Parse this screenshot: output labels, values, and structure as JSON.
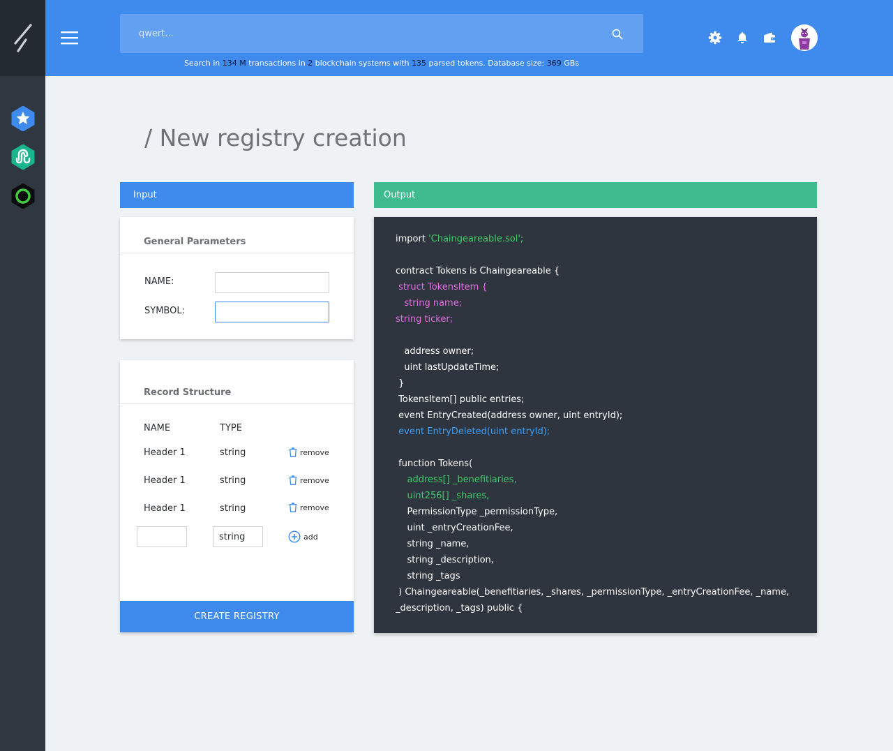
{
  "colors": {
    "topbar": "#3f8aed",
    "sidebar": "#2f3741",
    "input_header": "#3f8aed",
    "output_header": "#3fbb8f",
    "code_bg": "#2e353e",
    "code_string": "#3fcc6a",
    "code_struct": "#e36de3",
    "code_event": "#3f9ff2"
  },
  "sidebar": {
    "logo_icon": "slash-logo-icon",
    "apps": [
      {
        "icon": "star-badge-icon",
        "color": "#3f8aed"
      },
      {
        "icon": "stumbleupon-icon",
        "color": "#1ab48d"
      },
      {
        "icon": "ring-icon",
        "color": "#3fcc3f"
      }
    ]
  },
  "header": {
    "menu_icon": "hamburger-menu-icon",
    "search": {
      "placeholder": "qwert...",
      "icon": "search-icon"
    },
    "stats": {
      "prefix": "Search in",
      "transactions_count": "134 M",
      "mid1": "transactions in",
      "systems_count": "2",
      "mid2": "blockchain systems with",
      "tokens_count": "135",
      "mid3": "parsed tokens. Database size:",
      "db_size": "369",
      "suffix": "GBs"
    },
    "icons": [
      "gear-icon",
      "bell-icon",
      "wallet-icon"
    ],
    "avatar": "user-avatar"
  },
  "page": {
    "title": "/ New registry creation"
  },
  "input_panel": {
    "header": "Input",
    "general": {
      "title": "General Parameters",
      "name_label": "NAME:",
      "name_value": "",
      "symbol_label": "SYMBOL:",
      "symbol_value": ""
    },
    "record": {
      "title": "Record Structure",
      "col_name": "NAME",
      "col_type": "TYPE",
      "rows": [
        {
          "name": "Header 1",
          "type": "string",
          "action": "remove"
        },
        {
          "name": "Header 1",
          "type": "string",
          "action": "remove"
        },
        {
          "name": "Header 1",
          "type": "string",
          "action": "remove"
        }
      ],
      "new_row": {
        "name_value": "",
        "type_value": "string",
        "action": "add"
      }
    },
    "create_button": "CREATE REGISTRY"
  },
  "output_panel": {
    "header": "Output",
    "code": [
      {
        "text": "import ",
        "extra": "'Chaingeareable.sol';",
        "style": "import"
      },
      {
        "text": "",
        "style": "plain"
      },
      {
        "text": "contract Tokens is Chaingeareable {",
        "style": "plain"
      },
      {
        "text": " struct TokensItem {",
        "style": "struct"
      },
      {
        "text": "   string name;",
        "style": "struct"
      },
      {
        "text": "string ticker;",
        "style": "struct"
      },
      {
        "text": "",
        "style": "plain"
      },
      {
        "text": "   address owner;",
        "style": "plain"
      },
      {
        "text": "   uint lastUpdateTime;",
        "style": "plain"
      },
      {
        "text": " }",
        "style": "plain"
      },
      {
        "text": " TokensItem[] public entries;",
        "style": "plain"
      },
      {
        "text": " event EntryCreated(address owner, uint entryId);",
        "style": "plain"
      },
      {
        "text": " event EntryDeleted(uint entryId);",
        "style": "event"
      },
      {
        "text": "",
        "style": "plain"
      },
      {
        "text": " function Tokens(",
        "style": "plain"
      },
      {
        "text": "    address[] _benefitiaries,",
        "style": "string"
      },
      {
        "text": "    uint256[] _shares,",
        "style": "string"
      },
      {
        "text": "    PermissionType _permissionType,",
        "style": "plain"
      },
      {
        "text": "    uint _entryCreationFee,",
        "style": "plain"
      },
      {
        "text": "    string _name,",
        "style": "plain"
      },
      {
        "text": "    string _description,",
        "style": "plain"
      },
      {
        "text": "    string _tags",
        "style": "plain"
      },
      {
        "text": " ) Chaingeareable(_benefitiaries, _shares, _permissionType, _entryCreationFee, _name,",
        "style": "plain"
      },
      {
        "text": "_description, _tags) public {",
        "style": "plain"
      }
    ]
  }
}
